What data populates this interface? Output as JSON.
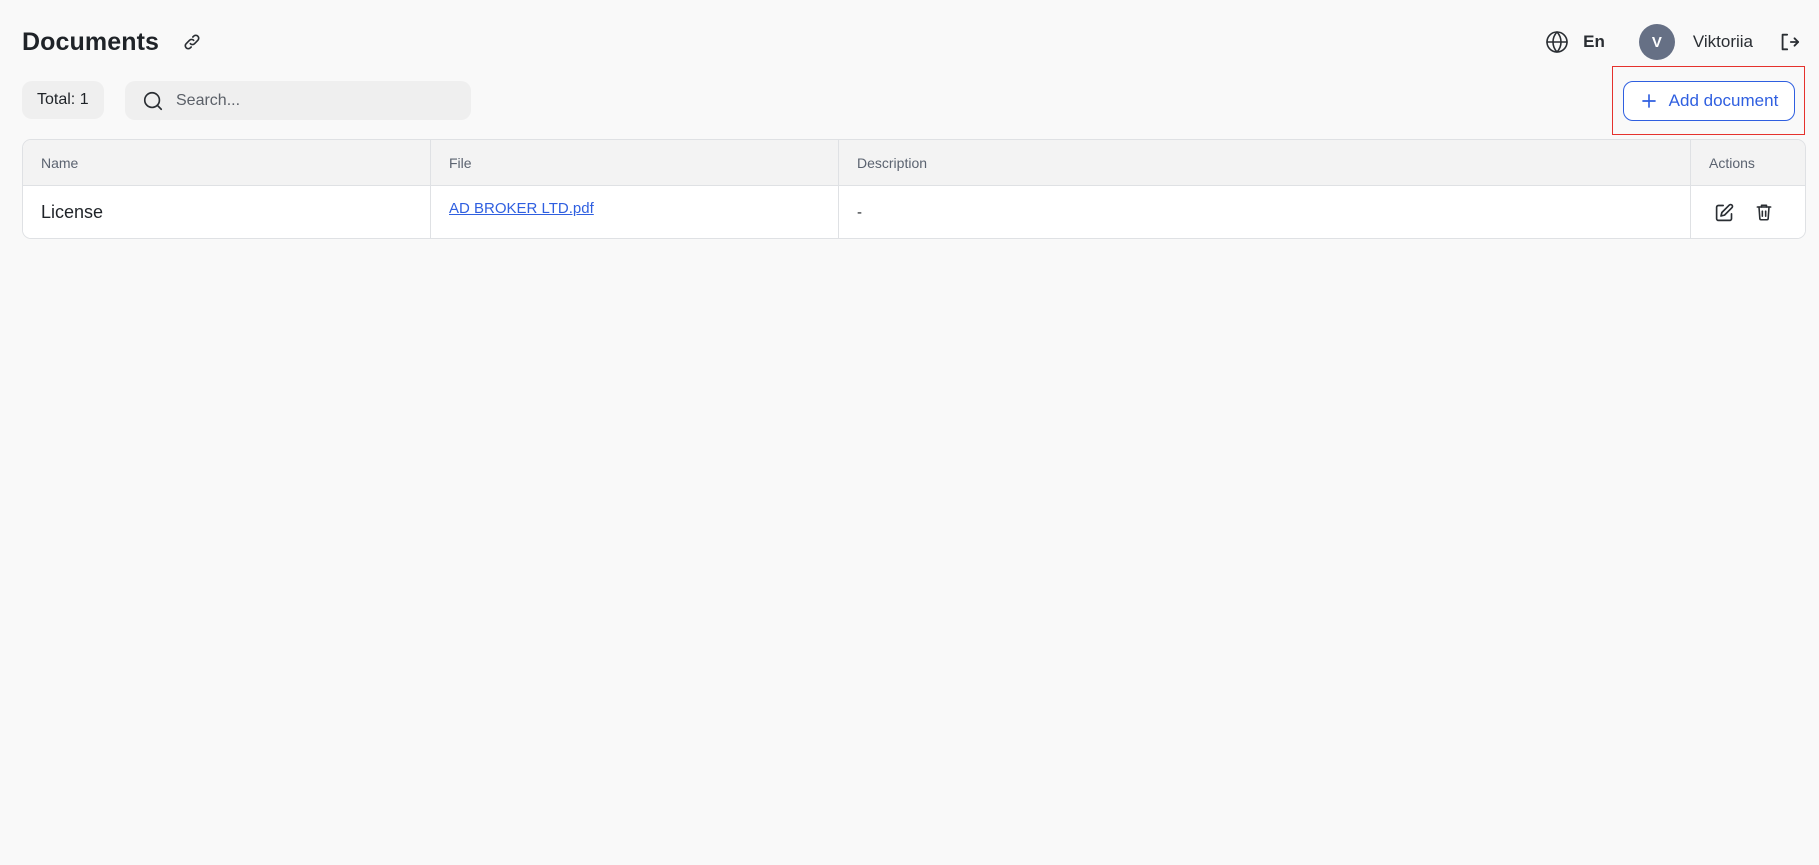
{
  "header": {
    "title": "Documents",
    "language": "En",
    "user": {
      "initial": "V",
      "name": "Viktoriia"
    }
  },
  "toolbar": {
    "total": "Total: 1",
    "search_placeholder": "Search...",
    "add_label": "Add document"
  },
  "table": {
    "columns": [
      "Name",
      "File",
      "Description",
      "Actions"
    ],
    "rows": [
      {
        "name": "License",
        "file": "AD BROKER LTD.pdf",
        "description": "-"
      }
    ]
  },
  "colors": {
    "accent": "#2f5fe0",
    "highlight_box": "#e5322d",
    "avatar_bg": "#667085"
  }
}
